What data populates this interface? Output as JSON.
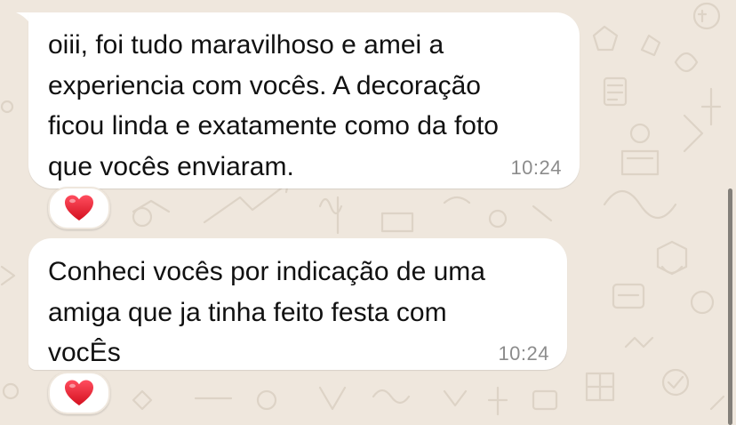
{
  "chat": {
    "messages": [
      {
        "text": "oiii, foi tudo maravilhoso e amei a\nexperiencia com vocês. A decoração\nficou linda e exatamente como da foto\nque vocês enviaram.",
        "time": "10:24",
        "reaction": "heart-icon"
      },
      {
        "text": "Conheci vocês por indicação de uma\namiga que ja tinha feito festa com\nvocÊs",
        "time": "10:24",
        "reaction": "heart-icon"
      }
    ]
  },
  "colors": {
    "wallpaper": "#efe7dd",
    "bubble": "#ffffff",
    "timestamp": "#8c8c8c",
    "reaction_heart": "#e0192b"
  }
}
